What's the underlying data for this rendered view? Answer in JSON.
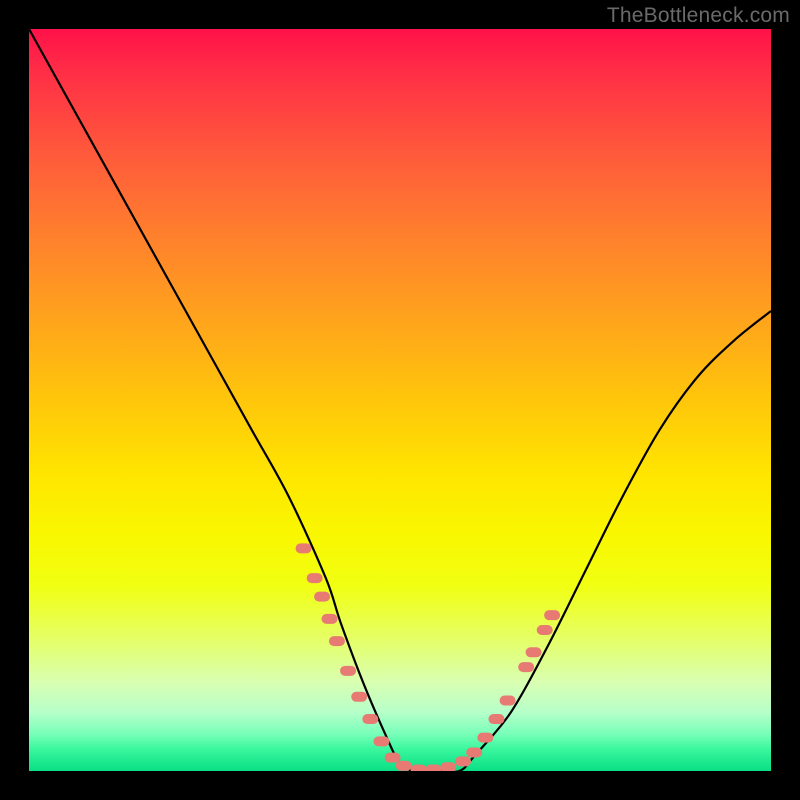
{
  "watermark": "TheBottleneck.com",
  "chart_data": {
    "type": "line",
    "title": "",
    "xlabel": "",
    "ylabel": "",
    "xlim": [
      0,
      100
    ],
    "ylim": [
      0,
      100
    ],
    "series": [
      {
        "name": "curve",
        "x": [
          0,
          5,
          10,
          15,
          20,
          25,
          30,
          35,
          40,
          42,
          45,
          48,
          50,
          52,
          55,
          58,
          60,
          65,
          70,
          75,
          80,
          85,
          90,
          95,
          100
        ],
        "y": [
          100,
          91,
          82,
          73,
          64,
          55,
          46,
          37,
          26,
          20,
          12,
          5,
          1,
          0,
          0,
          0,
          2,
          8,
          17,
          27,
          37,
          46,
          53,
          58,
          62
        ]
      }
    ],
    "markers": {
      "name": "dotted-segments",
      "color": "#e77a73",
      "points": [
        {
          "x": 37,
          "y": 30
        },
        {
          "x": 38.5,
          "y": 26
        },
        {
          "x": 39.5,
          "y": 23.5
        },
        {
          "x": 40.5,
          "y": 20.5
        },
        {
          "x": 41.5,
          "y": 17.5
        },
        {
          "x": 43,
          "y": 13.5
        },
        {
          "x": 44.5,
          "y": 10
        },
        {
          "x": 46,
          "y": 7
        },
        {
          "x": 47.5,
          "y": 4
        },
        {
          "x": 49,
          "y": 1.8
        },
        {
          "x": 50.5,
          "y": 0.7
        },
        {
          "x": 52.5,
          "y": 0.2
        },
        {
          "x": 54.5,
          "y": 0.2
        },
        {
          "x": 56.5,
          "y": 0.5
        },
        {
          "x": 58.5,
          "y": 1.3
        },
        {
          "x": 60,
          "y": 2.5
        },
        {
          "x": 61.5,
          "y": 4.5
        },
        {
          "x": 63,
          "y": 7
        },
        {
          "x": 64.5,
          "y": 9.5
        },
        {
          "x": 67,
          "y": 14
        },
        {
          "x": 68,
          "y": 16
        },
        {
          "x": 69.5,
          "y": 19
        },
        {
          "x": 70.5,
          "y": 21
        }
      ]
    }
  }
}
